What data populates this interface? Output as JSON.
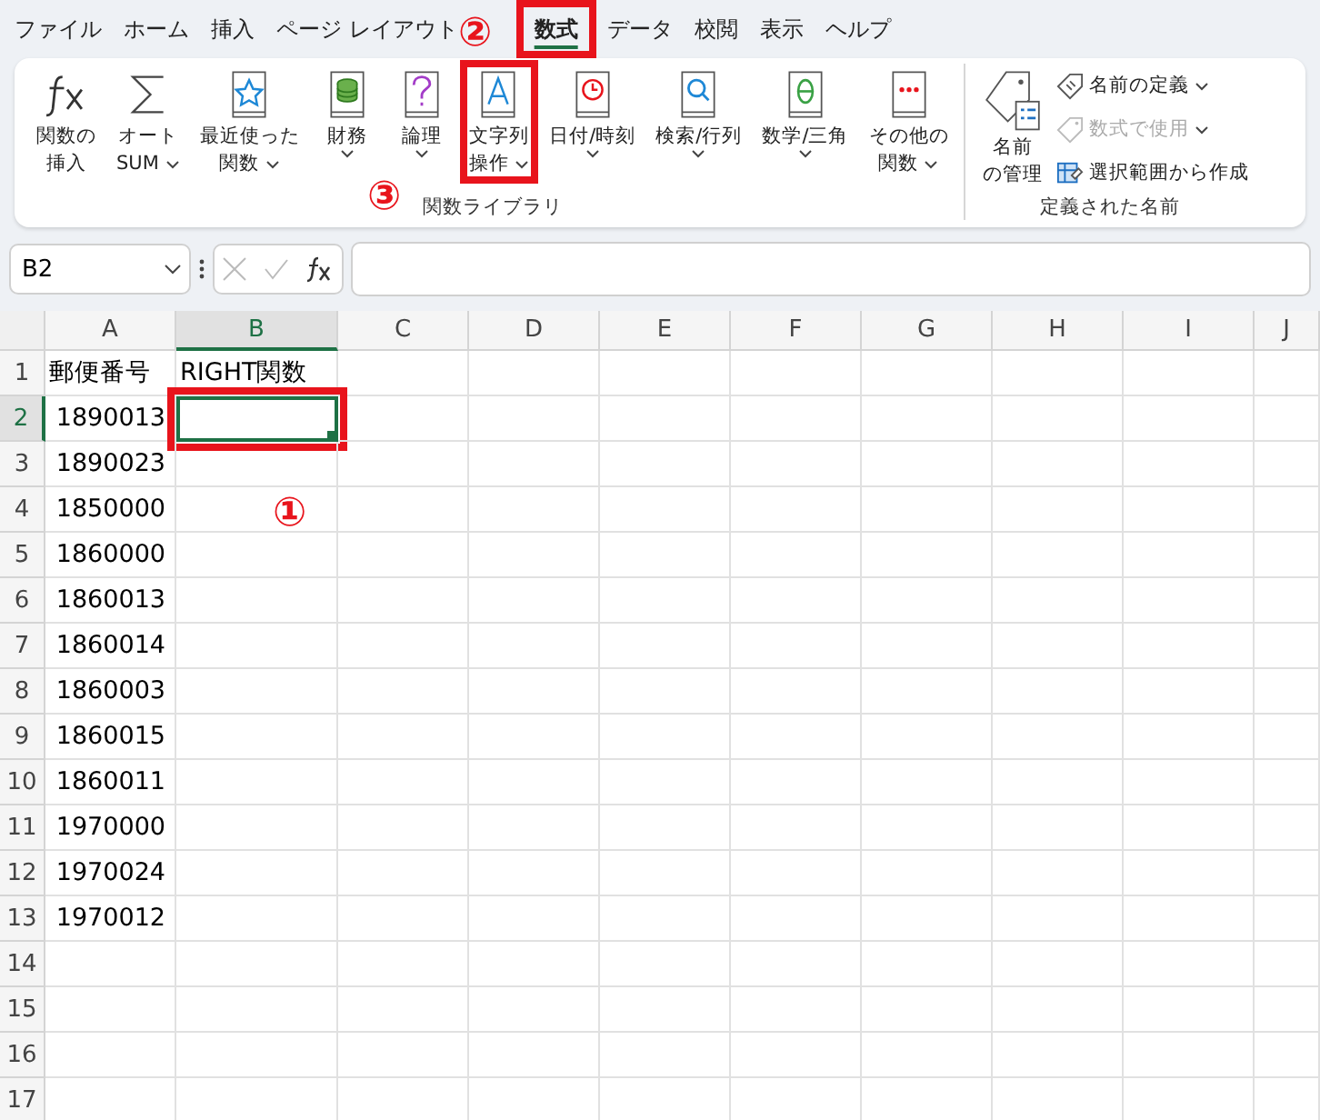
{
  "tabs": [
    {
      "label": "ファイル",
      "selected": false,
      "highlighted": false
    },
    {
      "label": "ホーム",
      "selected": false,
      "highlighted": false
    },
    {
      "label": "挿入",
      "selected": false,
      "highlighted": false
    },
    {
      "label": "ページ レイアウト",
      "selected": false,
      "highlighted": false
    },
    {
      "label": "数式",
      "selected": true,
      "highlighted": true
    },
    {
      "label": "データ",
      "selected": false,
      "highlighted": false
    },
    {
      "label": "校閲",
      "selected": false,
      "highlighted": false
    },
    {
      "label": "表示",
      "selected": false,
      "highlighted": false
    },
    {
      "label": "ヘルプ",
      "selected": false,
      "highlighted": false
    }
  ],
  "ribbon": {
    "groups": [
      {
        "title": "関数ライブラリ",
        "buttons": [
          {
            "kind": "fx",
            "lines": [
              "関数の",
              "挿入"
            ],
            "dropdown": false,
            "highlighted": false
          },
          {
            "kind": "sigma",
            "lines": [
              "オート",
              "SUM"
            ],
            "dropdown": true,
            "highlighted": false
          },
          {
            "kind": "star",
            "lines": [
              "最近使った",
              "関数"
            ],
            "dropdown": true,
            "highlighted": false
          },
          {
            "kind": "coins",
            "lines": [
              "財務"
            ],
            "dropdown": true,
            "highlighted": false
          },
          {
            "kind": "question",
            "lines": [
              "論理"
            ],
            "dropdown": true,
            "highlighted": false
          },
          {
            "kind": "letter",
            "lines": [
              "文字列",
              "操作"
            ],
            "dropdown": true,
            "highlighted": true
          },
          {
            "kind": "clock",
            "lines": [
              "日付/時刻"
            ],
            "dropdown": true,
            "highlighted": false
          },
          {
            "kind": "search",
            "lines": [
              "検索/行列"
            ],
            "dropdown": true,
            "highlighted": false
          },
          {
            "kind": "theta",
            "lines": [
              "数学/三角"
            ],
            "dropdown": true,
            "highlighted": false
          },
          {
            "kind": "dots",
            "lines": [
              "その他の",
              "関数"
            ],
            "dropdown": true,
            "highlighted": false
          }
        ]
      },
      {
        "title": "定義された名前",
        "buttons": [
          {
            "kind": "tag-list",
            "lines": [
              "名前",
              "の管理"
            ],
            "dropdown": false,
            "highlighted": false
          }
        ],
        "small_buttons": [
          {
            "kind": "tag",
            "label": "名前の定義",
            "dropdown": true,
            "disabled": false
          },
          {
            "kind": "tag-fx",
            "label": "数式で使用",
            "dropdown": true,
            "disabled": true
          },
          {
            "kind": "grid-tag",
            "label": "選択範囲から作成",
            "dropdown": false,
            "disabled": false
          }
        ]
      }
    ]
  },
  "formula_bar": {
    "name_box": "B2"
  },
  "sheet": {
    "columns": [
      {
        "label": "A",
        "selected": false
      },
      {
        "label": "B",
        "selected": true
      },
      {
        "label": "C",
        "selected": false
      },
      {
        "label": "D",
        "selected": false
      },
      {
        "label": "E",
        "selected": false
      },
      {
        "label": "F",
        "selected": false
      },
      {
        "label": "G",
        "selected": false
      },
      {
        "label": "H",
        "selected": false
      },
      {
        "label": "I",
        "selected": false
      },
      {
        "label": "J",
        "selected": false
      }
    ],
    "rows": [
      {
        "number": "1",
        "selected": false,
        "cells": [
          {
            "kind": "text",
            "text": "郵便番号",
            "active": false,
            "highlighted": false
          },
          {
            "kind": "text",
            "text": "RIGHT関数",
            "active": false,
            "highlighted": false
          }
        ]
      },
      {
        "number": "2",
        "selected": true,
        "cells": [
          {
            "kind": "number",
            "text": "1890013",
            "active": false,
            "highlighted": false
          },
          {
            "kind": "empty",
            "active": true,
            "highlighted": true
          }
        ]
      },
      {
        "number": "3",
        "selected": false,
        "cells": [
          {
            "kind": "number",
            "text": "1890023",
            "active": false,
            "highlighted": false
          }
        ]
      },
      {
        "number": "4",
        "selected": false,
        "cells": [
          {
            "kind": "number",
            "text": "1850000",
            "active": false,
            "highlighted": false
          }
        ]
      },
      {
        "number": "5",
        "selected": false,
        "cells": [
          {
            "kind": "number",
            "text": "1860000",
            "active": false,
            "highlighted": false
          }
        ]
      },
      {
        "number": "6",
        "selected": false,
        "cells": [
          {
            "kind": "number",
            "text": "1860013",
            "active": false,
            "highlighted": false
          }
        ]
      },
      {
        "number": "7",
        "selected": false,
        "cells": [
          {
            "kind": "number",
            "text": "1860014",
            "active": false,
            "highlighted": false
          }
        ]
      },
      {
        "number": "8",
        "selected": false,
        "cells": [
          {
            "kind": "number",
            "text": "1860003",
            "active": false,
            "highlighted": false
          }
        ]
      },
      {
        "number": "9",
        "selected": false,
        "cells": [
          {
            "kind": "number",
            "text": "1860015",
            "active": false,
            "highlighted": false
          }
        ]
      },
      {
        "number": "10",
        "selected": false,
        "cells": [
          {
            "kind": "number",
            "text": "1860011",
            "active": false,
            "highlighted": false
          }
        ]
      },
      {
        "number": "11",
        "selected": false,
        "cells": [
          {
            "kind": "number",
            "text": "1970000",
            "active": false,
            "highlighted": false
          }
        ]
      },
      {
        "number": "12",
        "selected": false,
        "cells": [
          {
            "kind": "number",
            "text": "1970024",
            "active": false,
            "highlighted": false
          }
        ]
      },
      {
        "number": "13",
        "selected": false,
        "cells": [
          {
            "kind": "number",
            "text": "1970012",
            "active": false,
            "highlighted": false
          }
        ]
      },
      {
        "number": "14",
        "selected": false
      },
      {
        "number": "15",
        "selected": false
      },
      {
        "number": "16",
        "selected": false
      },
      {
        "number": "17",
        "selected": false
      }
    ]
  },
  "annotations": [
    {
      "label": "①"
    },
    {
      "label": "②"
    },
    {
      "label": "③"
    }
  ]
}
